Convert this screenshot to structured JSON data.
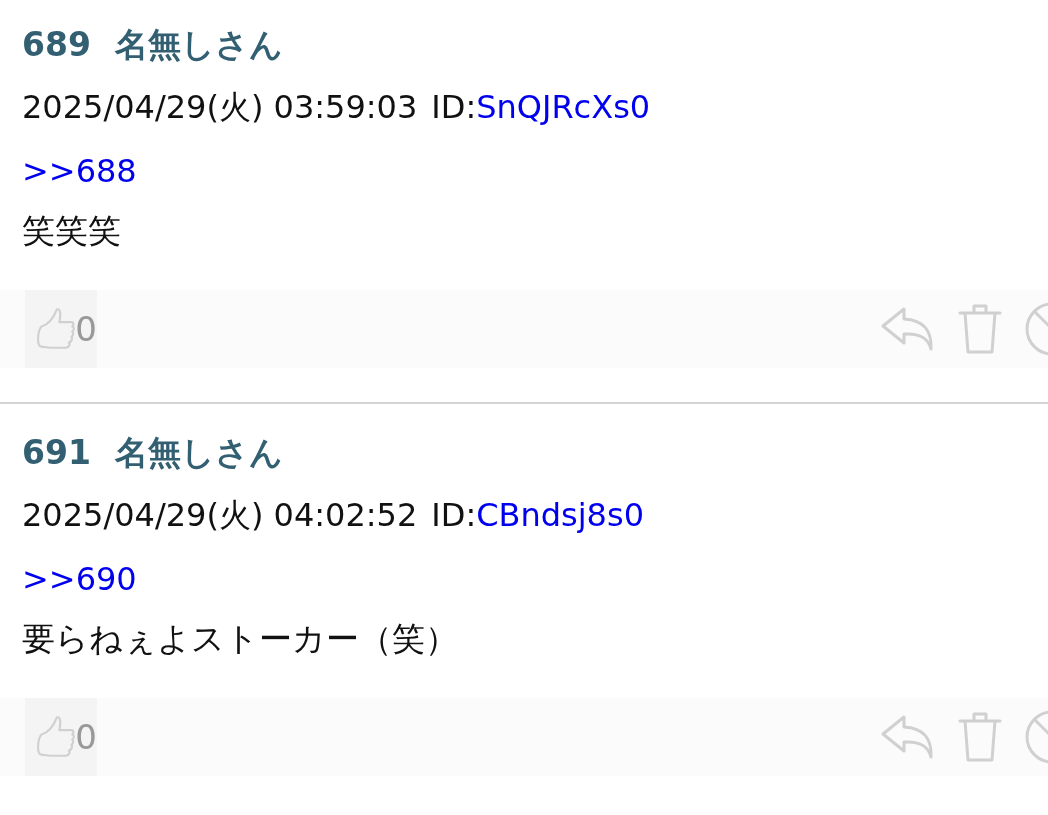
{
  "posts": [
    {
      "number": "689",
      "name": "名無しさん",
      "date": "2025/04/29(火) 03:59:03",
      "id_label": "ID:",
      "id": "SnQJRcXs0",
      "anchor": ">>688",
      "body": "笑笑笑",
      "likes": "0"
    },
    {
      "number": "691",
      "name": "名無しさん",
      "date": "2025/04/29(火) 04:02:52",
      "id_label": "ID:",
      "id": "CBndsj8s0",
      "anchor": ">>690",
      "body": "要らねぇよストーカー（笑）",
      "likes": "0"
    }
  ]
}
